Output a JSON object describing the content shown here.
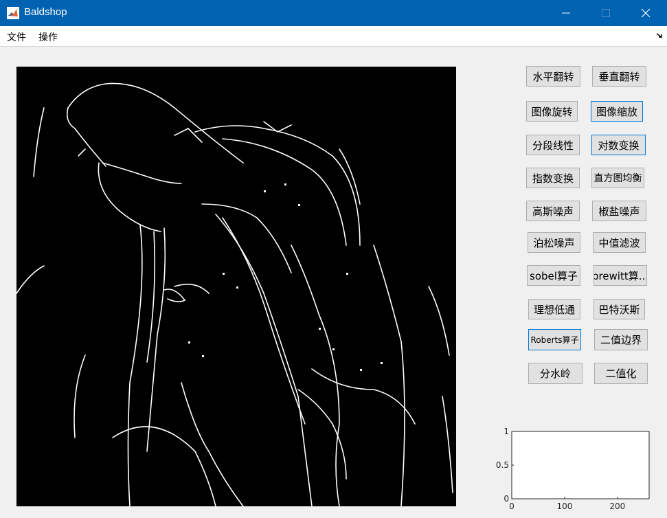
{
  "window": {
    "title": "Baldshop",
    "controls": [
      "minimize",
      "maximize",
      "close"
    ]
  },
  "menu": {
    "items": [
      "文件",
      "操作"
    ]
  },
  "image_panel": {
    "description_icon": "edge-detected-image",
    "accent": "#000000"
  },
  "buttons": [
    {
      "label": "水平翻转"
    },
    {
      "label": "垂直翻转"
    },
    {
      "label": "图像旋转"
    },
    {
      "label": "图像缩放"
    },
    {
      "label": "分段线性"
    },
    {
      "label": "对数变换"
    },
    {
      "label": "指数变换"
    },
    {
      "label": "直方图均衡"
    },
    {
      "label": "高斯噪声"
    },
    {
      "label": "椒盐噪声"
    },
    {
      "label": "泊松噪声"
    },
    {
      "label": "中值滤波"
    },
    {
      "label": "sobel算子"
    },
    {
      "label": "prewitt算..."
    },
    {
      "label": "理想低通"
    },
    {
      "label": "巴特沃斯"
    },
    {
      "label": "Roberts算子"
    },
    {
      "label": "二值边界"
    },
    {
      "label": "分水岭"
    },
    {
      "label": "二值化"
    }
  ],
  "chart_data": {
    "type": "line",
    "series": [],
    "xlim": [
      0,
      260
    ],
    "ylim": [
      0,
      1
    ],
    "xticks": [
      "0",
      "100",
      "200"
    ],
    "yticks": [
      "0",
      "0.5",
      "1"
    ],
    "grid": false
  },
  "colors": {
    "titlebar": "#0063b1",
    "focus_border": "#0078d7"
  }
}
